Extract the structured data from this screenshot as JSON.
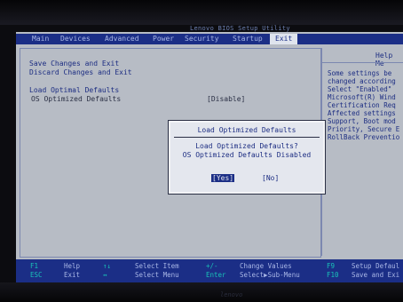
{
  "title": "Lenovo BIOS Setup Utility",
  "menu": {
    "items": [
      "Main",
      "Devices",
      "Advanced",
      "Power",
      "Security",
      "Startup",
      "Exit"
    ],
    "active": "Exit"
  },
  "options": {
    "save_exit": "Save Changes and Exit",
    "discard_exit": "Discard Changes and Exit",
    "load_defaults": "Load Optimal Defaults",
    "os_defaults_label": "OS Optimized Defaults",
    "os_defaults_value": "[Disable]"
  },
  "help": {
    "title": "Help Me",
    "lines": [
      "Some settings be",
      "changed according",
      " Select \"Enabled\"",
      "Microsoft(R) Wind",
      "Certification Req",
      "Affected settings",
      "Support, Boot mod",
      "Priority, Secure E",
      "RollBack Preventio"
    ]
  },
  "dialog": {
    "title": "Load Optimized Defaults",
    "question": "Load Optimized Defaults?",
    "status": "OS Optimized Defaults Disabled",
    "yes_label": "[Yes]",
    "no_label": "[No]"
  },
  "footer": {
    "f1_key": "F1",
    "f1_label": "Help",
    "esc_key": "ESC",
    "esc_label": "Exit",
    "updown_key": "↑↓",
    "updown_label": "Select Item",
    "leftright_key": "↔",
    "leftright_label": "Select Menu",
    "plusminus_key": "+/-",
    "plusminus_label": "Change Values",
    "enter_key": "Enter",
    "enter_label": "Select▶Sub-Menu",
    "f9_key": "F9",
    "f9_label": "Setup Defaul",
    "f10_key": "F10",
    "f10_label": "Save and Exi"
  },
  "brand": "lenovo"
}
